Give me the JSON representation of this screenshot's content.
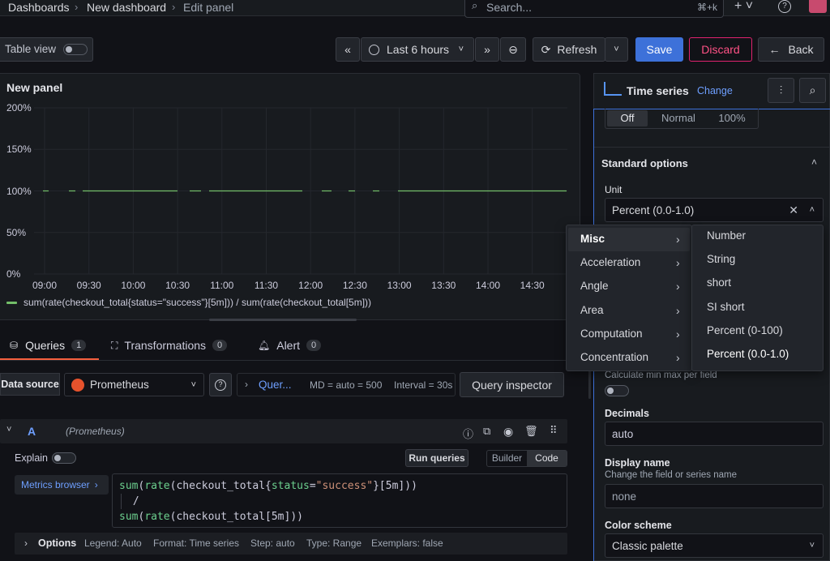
{
  "breadcrumbs": [
    "Dashboards",
    "New dashboard",
    "Edit panel"
  ],
  "search": {
    "placeholder": "Search...",
    "shortcut": "⌘+k"
  },
  "toolbar": {
    "table_view": "Table view",
    "time_range": "Last 6 hours",
    "refresh": "Refresh",
    "save": "Save",
    "discard": "Discard",
    "back": "Back"
  },
  "panel": {
    "title": "New panel",
    "legend": "sum(rate(checkout_total{status=\"success\"}[5m])) / sum(rate(checkout_total[5m]))"
  },
  "chart_data": {
    "type": "line",
    "title": "New panel",
    "x_ticks": [
      "09:00",
      "09:30",
      "10:00",
      "10:30",
      "11:00",
      "11:30",
      "12:00",
      "12:30",
      "13:00",
      "13:30",
      "14:00",
      "14:30"
    ],
    "y_ticks": [
      "200%",
      "150%",
      "100%",
      "50%",
      "0%"
    ],
    "ylim": [
      0,
      2
    ],
    "series": [
      {
        "name": "sum(rate(checkout_total{status=\"success\"}[5m])) / sum(rate(checkout_total[5m]))",
        "values": [
          1,
          1,
          1,
          1,
          1,
          1,
          1,
          1,
          1,
          1,
          1,
          1
        ],
        "color": "#73bf69"
      }
    ],
    "segments": [
      [
        53,
        60
      ],
      [
        85,
        93
      ],
      [
        102,
        219
      ],
      [
        234,
        248
      ],
      [
        258,
        373
      ],
      [
        397,
        409
      ],
      [
        430,
        438
      ],
      [
        460,
        468
      ],
      [
        491,
        699
      ]
    ]
  },
  "tabs": [
    {
      "label": "Queries",
      "count": "1"
    },
    {
      "label": "Transformations",
      "count": "0"
    },
    {
      "label": "Alert",
      "count": "0"
    }
  ],
  "query": {
    "datasource_label": "Data source",
    "datasource": "Prometheus",
    "options_short": "Quer...",
    "md": "MD = auto = 500",
    "interval": "Interval = 30s",
    "inspector": "Query inspector",
    "ref": "A",
    "ref_source": "(Prometheus)",
    "explain": "Explain",
    "run": "Run queries",
    "builder": "Builder",
    "code": "Code",
    "metrics_browser": "Metrics browser",
    "options_label": "Options",
    "options_summary": [
      "Legend: Auto",
      "Format: Time series",
      "Step: auto",
      "Type: Range",
      "Exemplars: false"
    ]
  },
  "viz": {
    "name": "Time series",
    "change": "Change",
    "stack": [
      "Off",
      "Normal",
      "100%"
    ],
    "standard_options": "Standard options",
    "unit_label": "Unit",
    "unit_value": "Percent (0.0-1.0)",
    "minmax_hint": "Calculate min max per field",
    "decimals_label": "Decimals",
    "decimals_value": "auto",
    "display_name_label": "Display name",
    "display_name_desc": "Change the field or series name",
    "display_name_placeholder": "none",
    "color_scheme_label": "Color scheme",
    "color_scheme_value": "Classic palette"
  },
  "unit_menu": {
    "categories": [
      "Misc",
      "Acceleration",
      "Angle",
      "Area",
      "Computation",
      "Concentration"
    ],
    "items": [
      "Number",
      "String",
      "short",
      "SI short",
      "Percent (0-100)",
      "Percent (0.0-1.0)"
    ]
  },
  "colors": {
    "primary": "#3d71d9",
    "discard": "#e0226e",
    "series": "#73bf69",
    "bg": "#111217",
    "panel": "#181b1f"
  }
}
